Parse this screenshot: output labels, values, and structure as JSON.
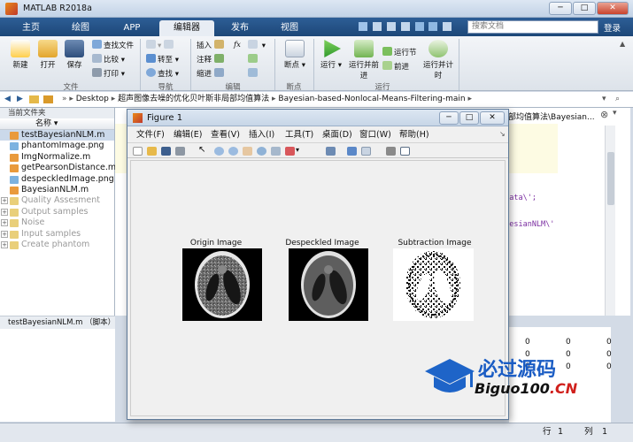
{
  "window": {
    "title": "MATLAB R2018a",
    "buttons": [
      "─",
      "□",
      "✕"
    ]
  },
  "tabs": [
    {
      "label": "主页",
      "active": false
    },
    {
      "label": "绘图",
      "active": false
    },
    {
      "label": "APP",
      "active": false
    },
    {
      "label": "编辑器",
      "active": true
    },
    {
      "label": "发布",
      "active": false
    },
    {
      "label": "视图",
      "active": false
    }
  ],
  "search": {
    "placeholder": "搜索文档",
    "login": "登录"
  },
  "ribbon": {
    "file": {
      "new": "新建",
      "open": "打开",
      "save": "保存",
      "find_file": "查找文件",
      "compare": "比较",
      "print": "打印"
    },
    "navigate": {
      "goto": "转至",
      "find": "查找"
    },
    "edit": {
      "insert": "插入",
      "comment": "注释",
      "indent": "缩进",
      "fx": "fx"
    },
    "breakpoints": {
      "label": "断点"
    },
    "run": {
      "run": "运行",
      "run_advance": "运行并前进",
      "run_section": "运行节",
      "advance": "前进",
      "run_time": "运行并计时"
    },
    "sections": {
      "file": "文件",
      "navigate": "导航",
      "edit": "编辑",
      "breakpoints": "断点",
      "run": "运行"
    }
  },
  "path": {
    "segments": [
      "Desktop",
      "超声图像去噪的优化贝叶斯非局部均值算法",
      "Bayesian-based-Nonlocal-Means-Filtering-main"
    ]
  },
  "current_folder": {
    "title": "当前文件夹",
    "column": "名称",
    "files": [
      {
        "name": "testBayesianNLM.m",
        "type": "m",
        "selected": true
      },
      {
        "name": "phantomImage.png",
        "type": "png",
        "selected": false
      },
      {
        "name": "ImgNormalize.m",
        "type": "m",
        "selected": false
      },
      {
        "name": "getPearsonDistance.m",
        "type": "m",
        "selected": false
      },
      {
        "name": "despeckledImage.png",
        "type": "png",
        "selected": false
      },
      {
        "name": "BayesianNLM.m",
        "type": "m",
        "selected": false
      },
      {
        "name": "Quality Assesment",
        "type": "dir",
        "selected": false
      },
      {
        "name": "Output samples",
        "type": "dir",
        "selected": false
      },
      {
        "name": "Noise",
        "type": "dir",
        "selected": false
      },
      {
        "name": "Input samples",
        "type": "dir",
        "selected": false
      },
      {
        "name": "Create phantom",
        "type": "dir",
        "selected": false
      }
    ],
    "status": "testBayesianNLM.m （脚本）"
  },
  "editor": {
    "tab_tail": "部均值算法\\Bayesian...",
    "code_fragments": [
      "yData\\';",
      "ayesianNLM\\'"
    ]
  },
  "workspace": {
    "values": [
      "0",
      "0",
      "0",
      "0",
      "0",
      "0",
      "0",
      "0",
      "0"
    ]
  },
  "figure": {
    "title": "Figure 1",
    "menus": [
      "文件(F)",
      "编辑(E)",
      "查看(V)",
      "插入(I)",
      "工具(T)",
      "桌面(D)",
      "窗口(W)",
      "帮助(H)"
    ],
    "plots": [
      {
        "title": "Origin Image"
      },
      {
        "title": "Despeckled Image"
      },
      {
        "title": "Subtraction Image"
      }
    ]
  },
  "statusbar": {
    "row_label": "行",
    "row": "1",
    "col_label": "列",
    "col": "1"
  },
  "watermark": {
    "brand": "必过源码",
    "domain": "Biguo100.CN"
  }
}
